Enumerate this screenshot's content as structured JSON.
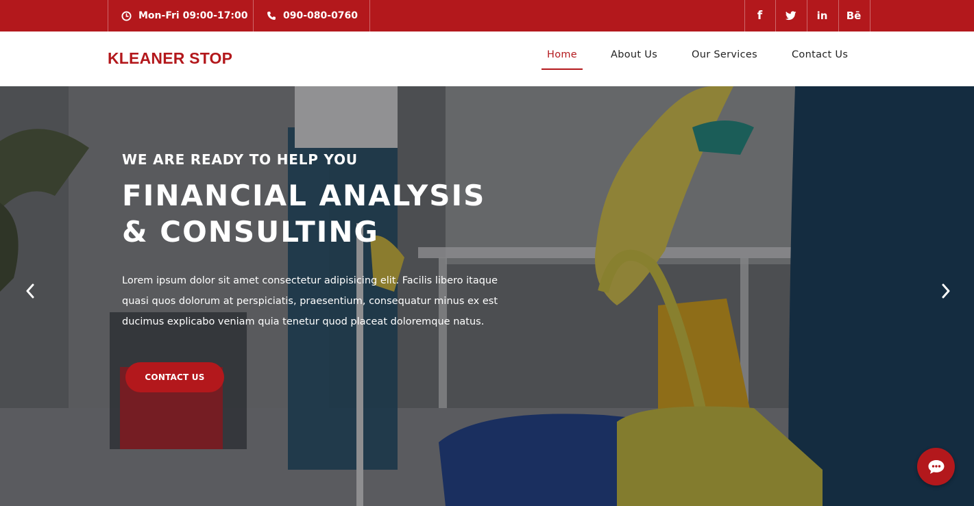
{
  "topbar": {
    "hours": "Mon-Fri 09:00-17:00",
    "phone": "090-080-0760",
    "social": [
      {
        "icon": "facebook-icon",
        "label": "f"
      },
      {
        "icon": "twitter-icon",
        "label": ""
      },
      {
        "icon": "linkedin-icon",
        "label": "in"
      },
      {
        "icon": "behance-icon",
        "label": "Bē"
      }
    ]
  },
  "header": {
    "logo": "KLEANER STOP",
    "nav": [
      {
        "label": "Home",
        "active": true
      },
      {
        "label": "About Us",
        "active": false
      },
      {
        "label": "Our Services",
        "active": false
      },
      {
        "label": "Contact Us",
        "active": false
      }
    ]
  },
  "hero": {
    "kicker": "WE ARE READY TO HELP YOU",
    "headline_line1": "FINANCIAL ANALYSIS",
    "headline_line2": "& CONSULTING",
    "intro": "Lorem ipsum dolor sit amet consectetur adipisicing elit. Facilis libero itaque quasi quos dolorum at perspiciatis, praesentium, consequatur minus ex est ducimus explicabo veniam quia tenetur quod placeat doloremque natus.",
    "cta_label": "CONTACT US",
    "prev_icon": "chevron-left-icon",
    "next_icon": "chevron-right-icon"
  },
  "chat": {
    "icon": "chat-bubble-icon"
  },
  "colors": {
    "brand": "#b3181c",
    "nav_text": "#222222",
    "white": "#ffffff"
  }
}
